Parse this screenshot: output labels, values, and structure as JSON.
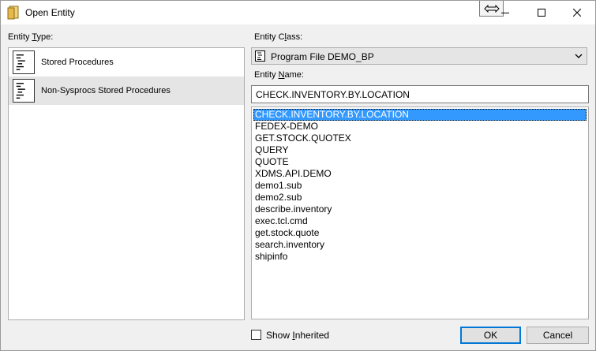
{
  "window": {
    "title": "Open Entity"
  },
  "entity_type": {
    "label_pre": "Entity ",
    "label_key": "T",
    "label_post": "ype:",
    "items": [
      {
        "label": "Stored Procedures",
        "selected": false
      },
      {
        "label": "Non-Sysprocs Stored Procedures",
        "selected": true
      }
    ]
  },
  "entity_class": {
    "label_pre": "Entity C",
    "label_key": "l",
    "label_post": "ass:",
    "selected": "Program File DEMO_BP"
  },
  "entity_name": {
    "label_pre": "Entity ",
    "label_key": "N",
    "label_post": "ame:",
    "value": "CHECK.INVENTORY.BY.LOCATION"
  },
  "entities": [
    "CHECK.INVENTORY.BY.LOCATION",
    "FEDEX-DEMO",
    "GET.STOCK.QUOTEX",
    "QUERY",
    "QUOTE",
    "XDMS.API.DEMO",
    "demo1.sub",
    "demo2.sub",
    "describe.inventory",
    "exec.tcl.cmd",
    "get.stock.quote",
    "search.inventory",
    "shipinfo"
  ],
  "selected_entity": "CHECK.INVENTORY.BY.LOCATION",
  "show_inherited": {
    "label_pre": "Show ",
    "label_key": "I",
    "label_post": "nherited",
    "checked": false
  },
  "buttons": {
    "ok": "OK",
    "cancel": "Cancel"
  }
}
